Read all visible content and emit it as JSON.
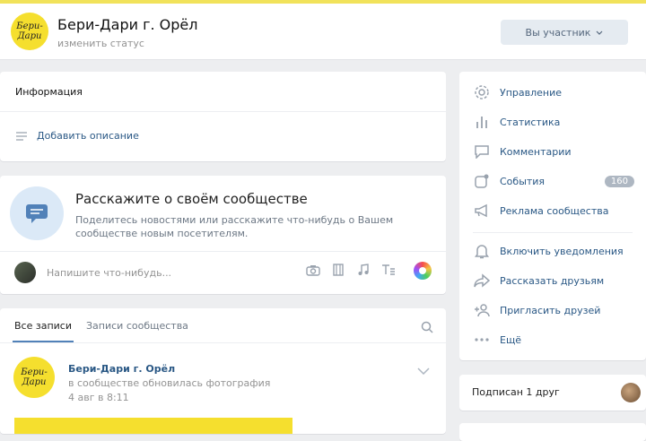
{
  "group": {
    "title": "Бери-Дари г. Орёл",
    "status": "изменить статус",
    "logo_text": "Бери-Дари",
    "member_button": "Вы участник"
  },
  "info": {
    "title": "Информация",
    "add_description": "Добавить описание"
  },
  "compose": {
    "title": "Расскажите о своём сообществе",
    "subtitle": "Поделитесь новостями или расскажите что-нибудь о Вашем сообществе новым посетителям.",
    "input_placeholder": "Напишите что-нибудь..."
  },
  "posts": {
    "tabs": [
      "Все записи",
      "Записи сообщества"
    ],
    "post": {
      "author": "Бери-Дари г. Орёл",
      "action": "в сообществе обновилась фотография",
      "date": "4 авг в 8:11"
    }
  },
  "menu": {
    "items": [
      {
        "label": "Управление",
        "icon": "gear-icon"
      },
      {
        "label": "Статистика",
        "icon": "stats-icon"
      },
      {
        "label": "Комментарии",
        "icon": "comment-icon"
      },
      {
        "label": "События",
        "icon": "events-icon",
        "badge": "160"
      },
      {
        "label": "Реклама сообщества",
        "icon": "megaphone-icon"
      },
      {
        "label": "Включить уведомления",
        "icon": "bell-icon"
      },
      {
        "label": "Рассказать друзьям",
        "icon": "share-icon"
      },
      {
        "label": "Пригласить друзей",
        "icon": "invite-icon"
      },
      {
        "label": "Ещё",
        "icon": "more-icon"
      }
    ]
  },
  "friends": {
    "label": "Подписан 1 друг"
  },
  "colors": {
    "accent": "#5181b8",
    "link": "#2a5885",
    "brand_yellow": "#f5df2e",
    "background": "#edeef0"
  }
}
